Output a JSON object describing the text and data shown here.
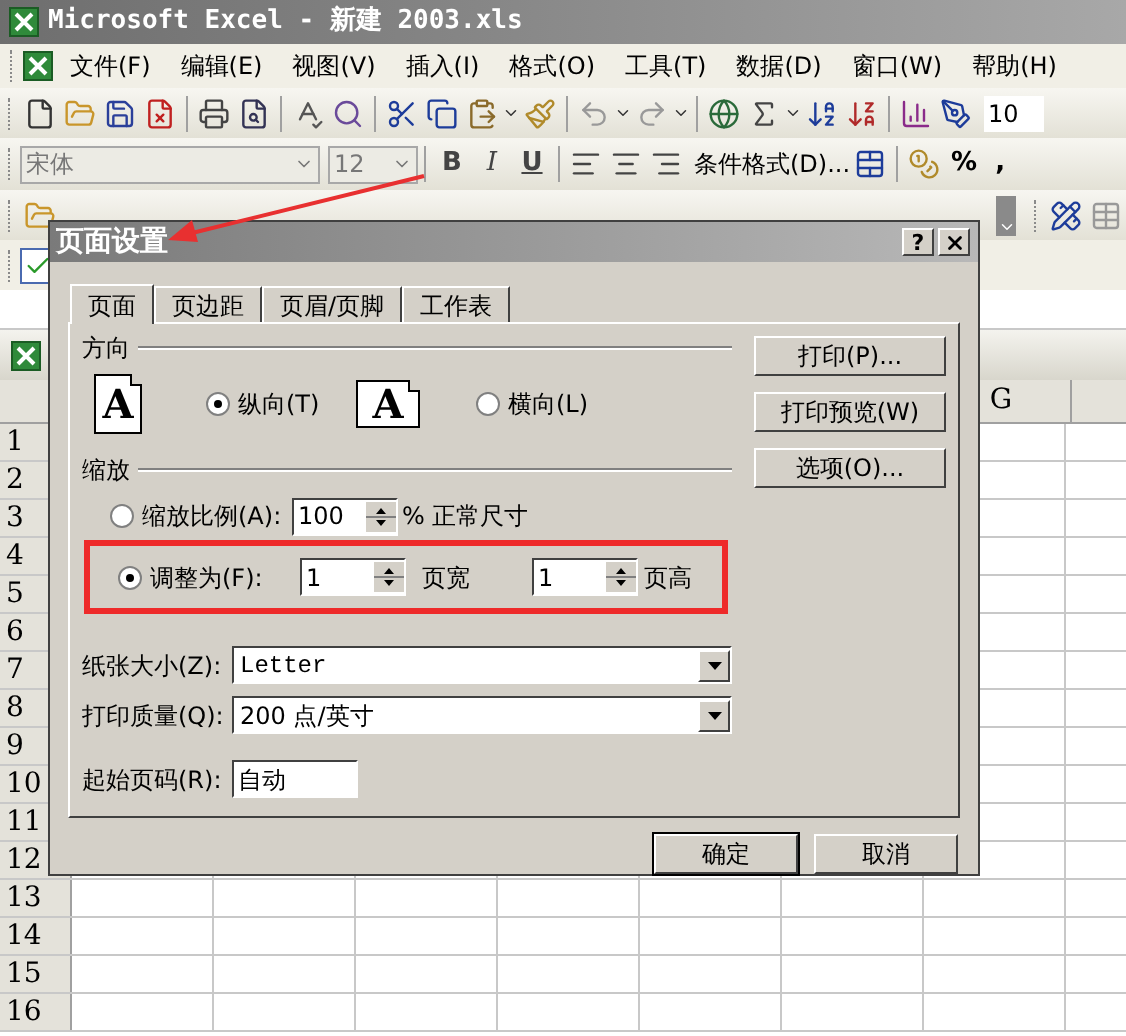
{
  "window": {
    "title": "Microsoft Excel - 新建 2003.xls"
  },
  "menu": [
    "文件(F)",
    "编辑(E)",
    "视图(V)",
    "插入(I)",
    "格式(O)",
    "工具(T)",
    "数据(D)",
    "窗口(W)",
    "帮助(H)"
  ],
  "standard_toolbar": {
    "zoom": "10"
  },
  "format_toolbar": {
    "font": "宋体",
    "size": "12",
    "bold": "B",
    "italic": "I",
    "underline": "U",
    "conditional_format": "条件格式(D)...",
    "percent": "%",
    "comma": ","
  },
  "sheet": {
    "columns": [
      "G"
    ],
    "rows": [
      "1",
      "2",
      "3",
      "4",
      "5",
      "6",
      "7",
      "8",
      "9",
      "10",
      "11",
      "12",
      "13",
      "14",
      "15",
      "16"
    ]
  },
  "dialog": {
    "title": "页面设置",
    "help": "?",
    "tabs": [
      {
        "label": "页面",
        "selected": true
      },
      {
        "label": "页边距",
        "selected": false
      },
      {
        "label": "页眉/页脚",
        "selected": false
      },
      {
        "label": "工作表",
        "selected": false
      }
    ],
    "orientation": {
      "title": "方向",
      "options": [
        {
          "kind": "portrait",
          "glyph": "A",
          "label": "纵向(T)",
          "selected": true
        },
        {
          "kind": "landscape",
          "glyph": "A",
          "label": "横向(L)",
          "selected": false
        }
      ]
    },
    "scaling": {
      "title": "缩放",
      "options": [
        {
          "kind": "percent",
          "label": "缩放比例(A):",
          "selected": false,
          "value": "100",
          "suffix": "% 正常尺寸",
          "highlighted": false
        },
        {
          "kind": "fit",
          "label": "调整为(F):",
          "selected": true,
          "value": "1",
          "unit": "页宽",
          "value_2": "1",
          "unit_2": "页高",
          "highlighted": true
        }
      ]
    },
    "paper_size": {
      "label": "纸张大小(Z):",
      "value": "Letter"
    },
    "print_quality": {
      "label": "打印质量(Q):",
      "value": "200 点/英寸"
    },
    "first_page": {
      "label": "起始页码(R):",
      "value": "自动"
    },
    "side_buttons": [
      "打印(P)...",
      "打印预览(W)",
      "选项(O)..."
    ],
    "buttons": [
      "确定",
      "取消"
    ]
  }
}
